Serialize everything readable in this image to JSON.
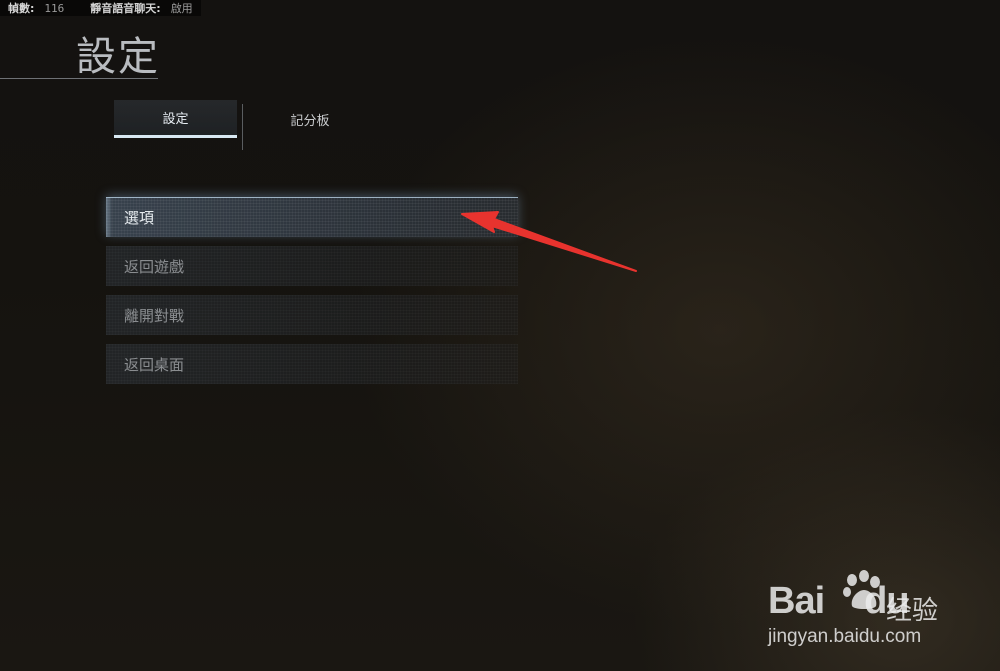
{
  "status_bar": {
    "fps_label": "幀數:",
    "fps_value": "116",
    "voice_chat_label": "靜音語音聊天:",
    "voice_chat_value": "啟用"
  },
  "page_title": "設定",
  "tabs": [
    {
      "label": "設定",
      "active": true
    },
    {
      "label": "記分板",
      "active": false
    }
  ],
  "menu": {
    "items": [
      {
        "label": "選項",
        "active": true
      },
      {
        "label": "返回遊戲",
        "active": false
      },
      {
        "label": "離開對戰",
        "active": false
      },
      {
        "label": "返回桌面",
        "active": false
      }
    ]
  },
  "annotation": {
    "color": "#e8332e",
    "icon": "red-arrow-pointing-to-options"
  },
  "watermark": {
    "logo_text": "Bai",
    "logo_text_2": "du",
    "cn_text": "经验",
    "url": "jingyan.baidu.com"
  }
}
